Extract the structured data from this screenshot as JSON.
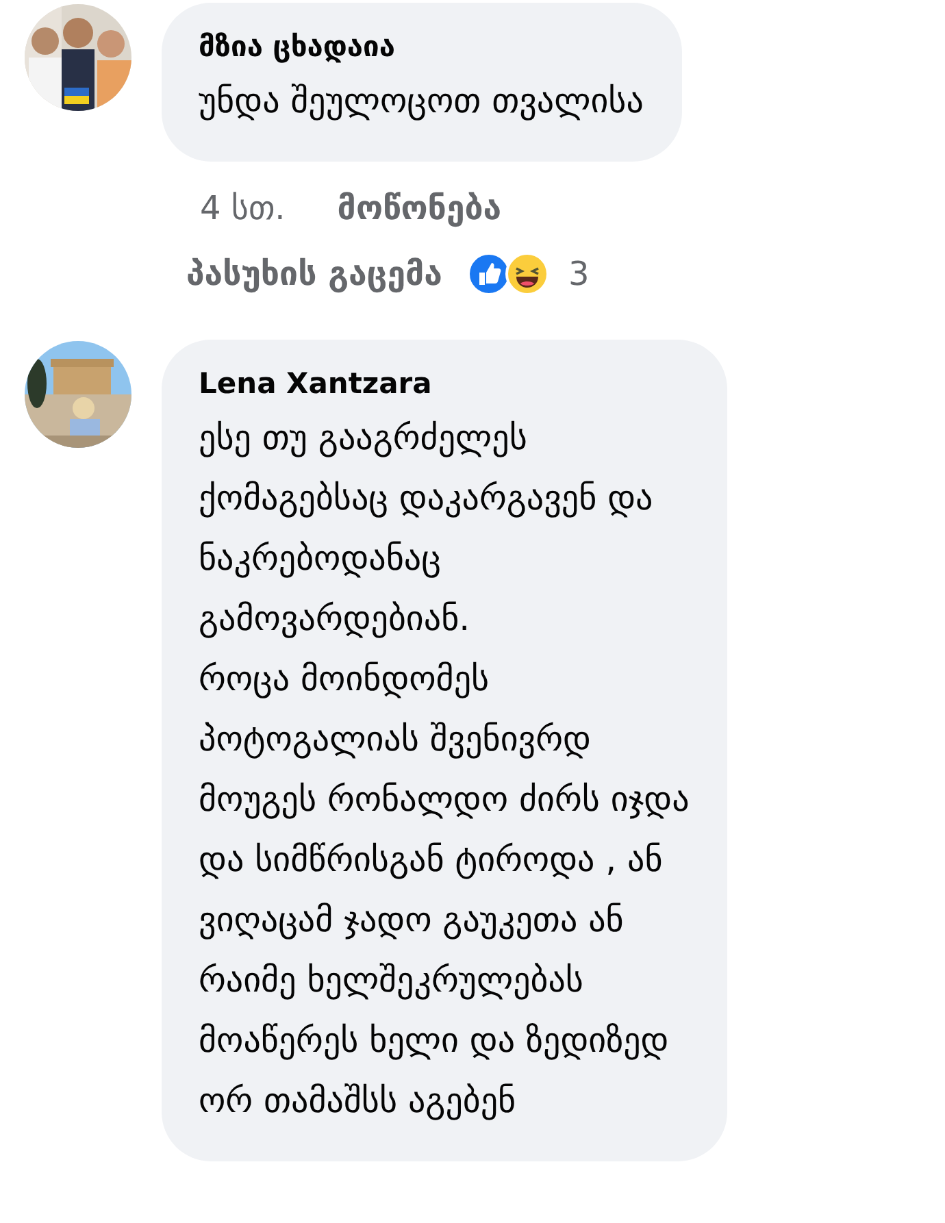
{
  "comments": [
    {
      "author": "მზია ცხადაია",
      "text": "უნდა შეულოცოთ თვალისა",
      "time": "4 სთ.",
      "like_label": "მოწონება",
      "reply_label": "პასუხის გაცემა",
      "reactions": {
        "count": "3"
      }
    },
    {
      "author": "Lena Xantzara",
      "text": "ესე თუ გააგრძელეს\nქომაგებსაც დაკარგავენ და\nნაკრებოდანაც\nგამოვარდებიან.\nროცა მოინდომეს\nპოტოგალიას შვენივრდ\nმოუგეს რონალდო ძირს იჯდა\nდა სიმწრისგან ტიროდა , ან\nვიღაცამ ჯადო გაუკეთა ან\nრაიმე ხელშეკრულებას\nმოაწერეს ხელი და ზედიზედ\nორ თამაშსს აგებენ"
    }
  ]
}
